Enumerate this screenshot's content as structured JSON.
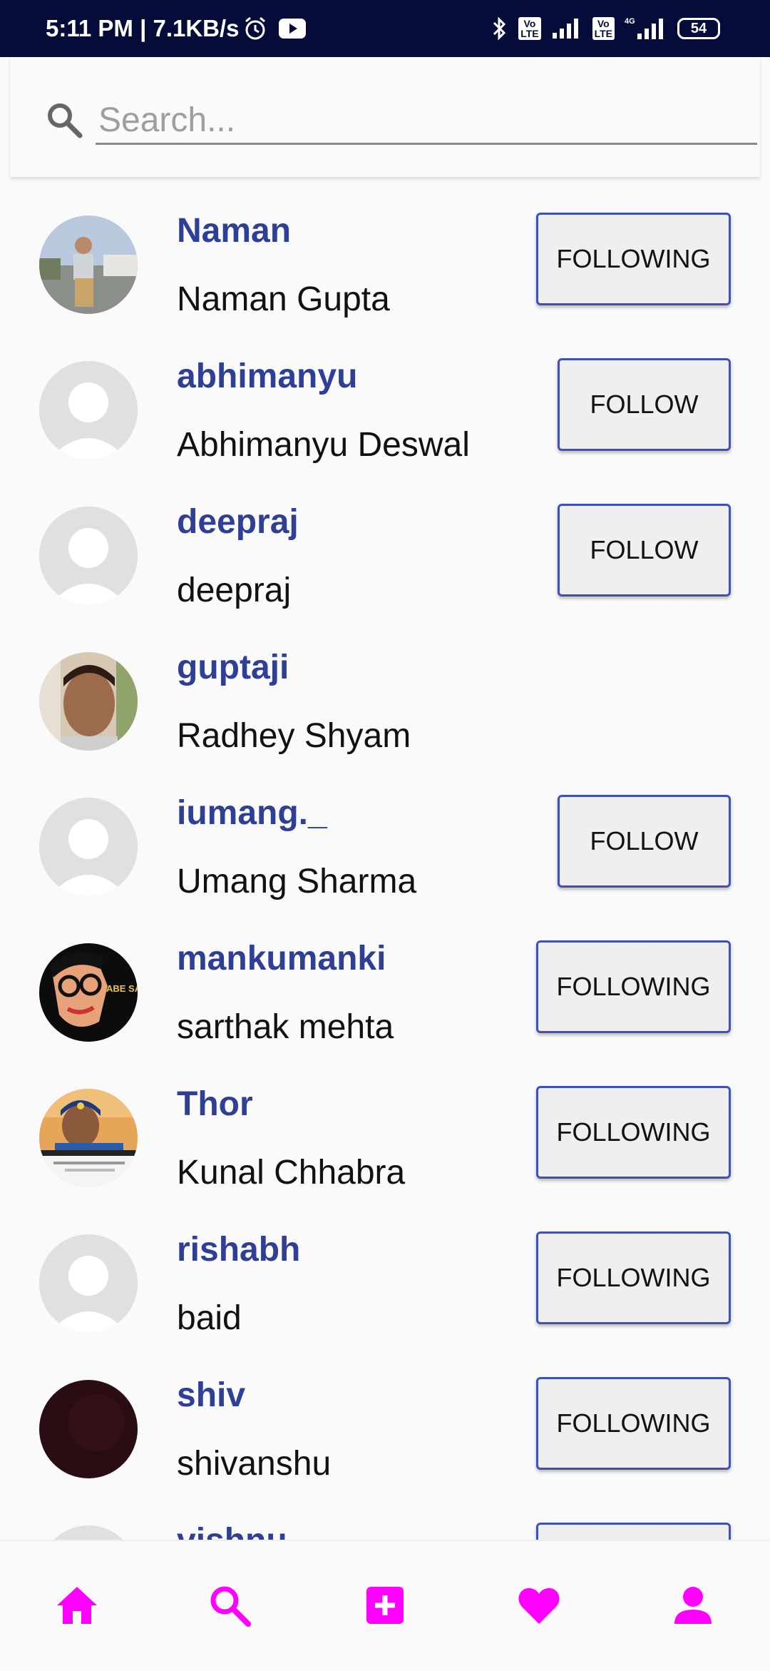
{
  "status_bar": {
    "time": "5:11 PM | 7.1KB/s",
    "battery": "54",
    "lte_label": "Vo LTE",
    "network_label": "4G"
  },
  "search": {
    "placeholder": "Search..."
  },
  "users": [
    {
      "username": "Naman",
      "fullname": "Naman Gupta",
      "button": "FOLLOWING",
      "avatar": "photo-boy"
    },
    {
      "username": "abhimanyu",
      "fullname": "Abhimanyu Deswal",
      "button": "FOLLOW",
      "avatar": "default"
    },
    {
      "username": "deepraj",
      "fullname": "deepraj",
      "button": "FOLLOW",
      "avatar": "default"
    },
    {
      "username": "guptaji",
      "fullname": "Radhey Shyam",
      "button": "",
      "avatar": "photo-face"
    },
    {
      "username": "iumang._",
      "fullname": "Umang Sharma",
      "button": "FOLLOW",
      "avatar": "default"
    },
    {
      "username": "mankumanki",
      "fullname": "sarthak mehta",
      "button": "FOLLOWING",
      "avatar": "cartoon",
      "avatar_text": "ABE SAALE !"
    },
    {
      "username": "Thor",
      "fullname": "Kunal Chhabra",
      "button": "FOLLOWING",
      "avatar": "photo-cricketer"
    },
    {
      "username": "rishabh",
      "fullname": "baid",
      "button": "FOLLOWING",
      "avatar": "default"
    },
    {
      "username": "shiv",
      "fullname": "shivanshu",
      "button": "FOLLOWING",
      "avatar": "dark"
    },
    {
      "username": "vishnu",
      "fullname": "",
      "button": "",
      "avatar": "default"
    }
  ],
  "bottom_nav": [
    {
      "icon": "home-icon"
    },
    {
      "icon": "search-icon"
    },
    {
      "icon": "add-post-icon"
    },
    {
      "icon": "heart-icon"
    },
    {
      "icon": "profile-icon"
    }
  ],
  "colors": {
    "accent": "#ff00ff",
    "username": "#2f3f95",
    "button_border": "#3f51b5",
    "status_bar": "#050c3a"
  }
}
